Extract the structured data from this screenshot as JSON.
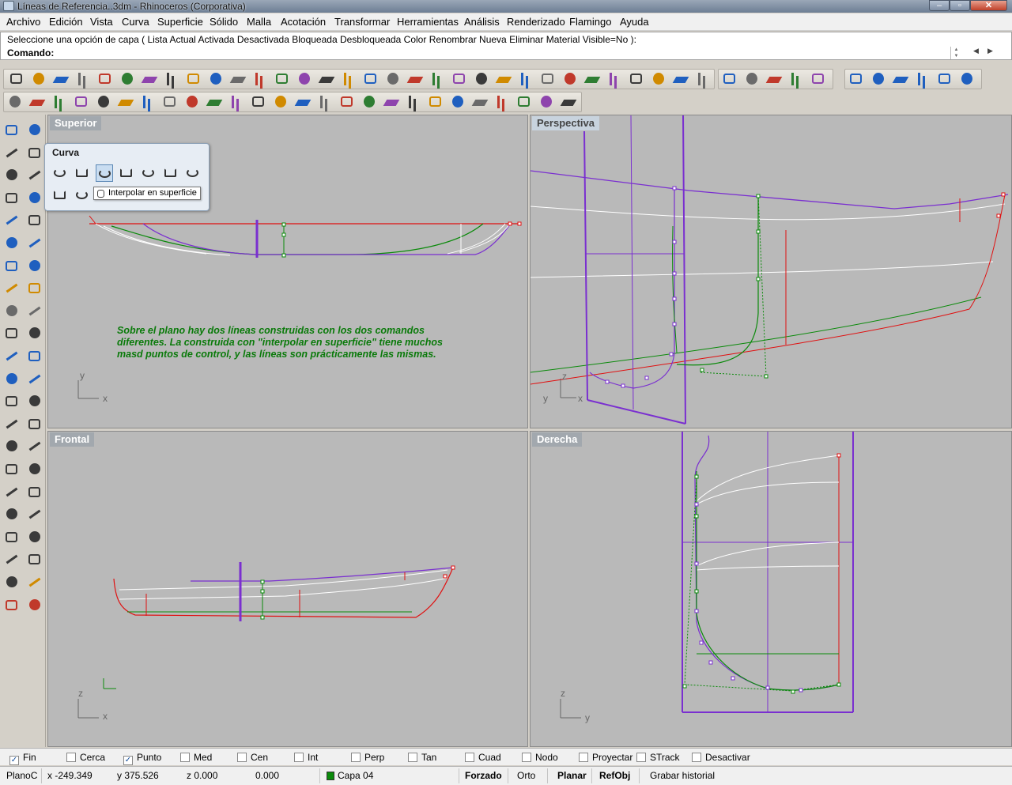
{
  "window": {
    "title": "Líneas de Referencia..3dm - Rhinoceros (Corporativa)",
    "minimize": "–",
    "maximize": "▫",
    "close": "✕"
  },
  "menu": [
    "Archivo",
    "Edición",
    "Vista",
    "Curva",
    "Superficie",
    "Sólido",
    "Malla",
    "Acotación",
    "Transformar",
    "Herramientas",
    "Análisis",
    "Renderizado",
    "Flamingo",
    "Ayuda"
  ],
  "command": {
    "history": "Seleccione una opción de capa ( Lista  Actual  Activada  Desactivada  Bloqueada  Desbloqueada  Color  Renombrar  Nueva  Eliminar  Material  Visible=No ):",
    "prompt": "Comando:",
    "value": ""
  },
  "viewports": {
    "top": "Superior",
    "perspective": "Perspectiva",
    "front": "Frontal",
    "right": "Derecha"
  },
  "axes": {
    "x": "x",
    "y": "y",
    "z": "z"
  },
  "flyout": {
    "title": "Curva",
    "tooltip": "Interpolar en superficie"
  },
  "note": "Sobre el plano hay dos líneas construidas con los dos comandos\ndiferentes. La construida con \"interpolar en superficie\" tiene muchos\nmasd puntos de control, y las líneas son prácticamente las mismas.",
  "osnaps": [
    {
      "label": "Fin",
      "checked": true
    },
    {
      "label": "Cerca",
      "checked": false
    },
    {
      "label": "Punto",
      "checked": true
    },
    {
      "label": "Med",
      "checked": false
    },
    {
      "label": "Cen",
      "checked": false
    },
    {
      "label": "Int",
      "checked": false
    },
    {
      "label": "Perp",
      "checked": false
    },
    {
      "label": "Tan",
      "checked": false
    },
    {
      "label": "Cuad",
      "checked": false
    },
    {
      "label": "Nodo",
      "checked": false
    },
    {
      "label": "Proyectar",
      "checked": false
    },
    {
      "label": "STrack",
      "checked": false
    },
    {
      "label": "Desactivar",
      "checked": false
    }
  ],
  "status": {
    "cplane": "PlanoC",
    "x": "x -249.349",
    "y": "y 375.526",
    "z": "z 0.000",
    "dist": "0.000",
    "layer": "Capa 04",
    "layer_color": "#0a8a0a",
    "snap": "Forzado",
    "ortho": "Orto",
    "planar": "Planar",
    "osnap": "RefObj",
    "history": "Grabar historial"
  },
  "colors": {
    "viewport_bg": "#b9b9b9",
    "curve_red": "#e01010",
    "curve_green": "#0a8a0a",
    "curve_purple": "#7a2fd0",
    "curve_white": "#ffffff"
  }
}
